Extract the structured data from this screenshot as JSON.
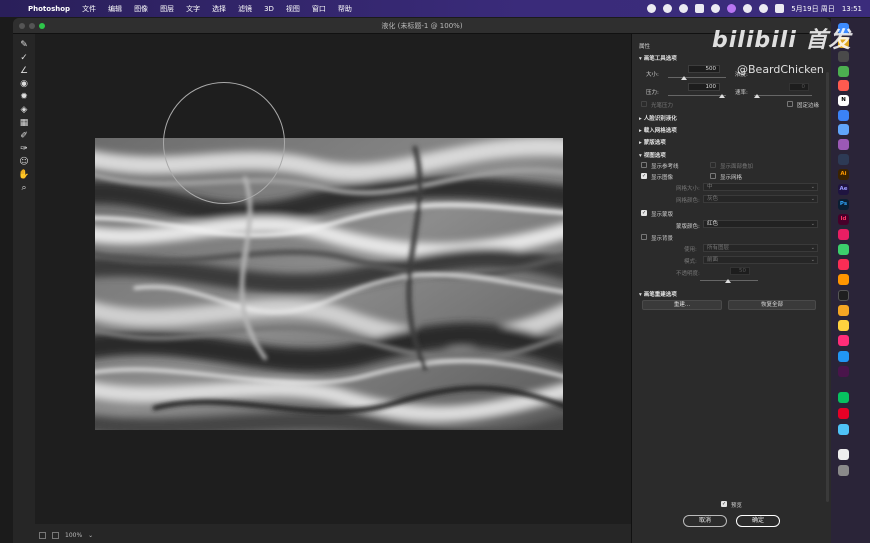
{
  "menubar": {
    "apple_icon": "apple-icon",
    "items": [
      "Photoshop",
      "文件",
      "编辑",
      "图像",
      "图层",
      "文字",
      "选择",
      "滤镜",
      "3D",
      "视图",
      "窗口",
      "帮助"
    ],
    "date": "5月19日 周日",
    "time": "13:51"
  },
  "window": {
    "title": "液化 (未标题-1 @ 100%)"
  },
  "statusbar": {
    "zoom": "100%"
  },
  "panel": {
    "header": "属性",
    "brush_section": {
      "title": "画笔工具选项",
      "size_label": "大小:",
      "size_value": "500",
      "density_label": "浓度:",
      "pressure_label": "压力:",
      "pressure_value": "100",
      "rate_label": "速率:",
      "rate_value": "0",
      "stylus_label": "光笔压力",
      "pin_edges_label": "固定边缘"
    },
    "collapsed_sections": [
      "人脸识别液化",
      "载入网格选项",
      "蒙版选项"
    ],
    "view_section": {
      "title": "视图选项",
      "show_guides": "显示参考线",
      "show_face_overlay": "显示面部叠加",
      "show_image": "显示图像",
      "show_mesh": "显示网格",
      "mesh_size_label": "网格大小:",
      "mesh_size_value": "中",
      "mesh_color_label": "网格颜色:",
      "mesh_color_value": "灰色",
      "show_mask": "显示蒙版",
      "mask_color_label": "蒙版颜色:",
      "mask_color_value": "红色",
      "show_backdrop": "显示背景",
      "use_label": "使用:",
      "use_value": "所有图层",
      "mode_label": "模式:",
      "mode_value": "前面",
      "opacity_label": "不透明度:",
      "opacity_value": "50"
    },
    "reconstruct_section": {
      "title": "画笔重建选项",
      "reconstruct_button": "重建...",
      "restore_all_button": "恢复全部"
    },
    "preview_label": "预览",
    "cancel_button": "取消",
    "ok_button": "确定"
  },
  "dock": {
    "items": [
      "finder",
      "chrome",
      "chrome-canary",
      "notion",
      "appstore",
      "xcode",
      "podcast",
      "figma",
      "illustrator",
      "after-effects",
      "photoshop",
      "indesign",
      "pixelmator",
      "maps",
      "music",
      "photos",
      "blender",
      "sketch",
      "toolbox",
      "safari",
      "slack",
      "wechat",
      "netease-music",
      "timemachine",
      "documents",
      "trash"
    ],
    "labels": {
      "illustrator": "Ai",
      "after_effects": "Ae",
      "photoshop": "Ps",
      "indesign": "Id",
      "notion": "N"
    }
  },
  "watermark": {
    "logo": "bilibili 首发",
    "user": "@BeardChicken"
  },
  "colors": {
    "menubar": "#2f2366",
    "panel_bg": "#2b2b2b",
    "window_zoom": "#2ec64a"
  }
}
